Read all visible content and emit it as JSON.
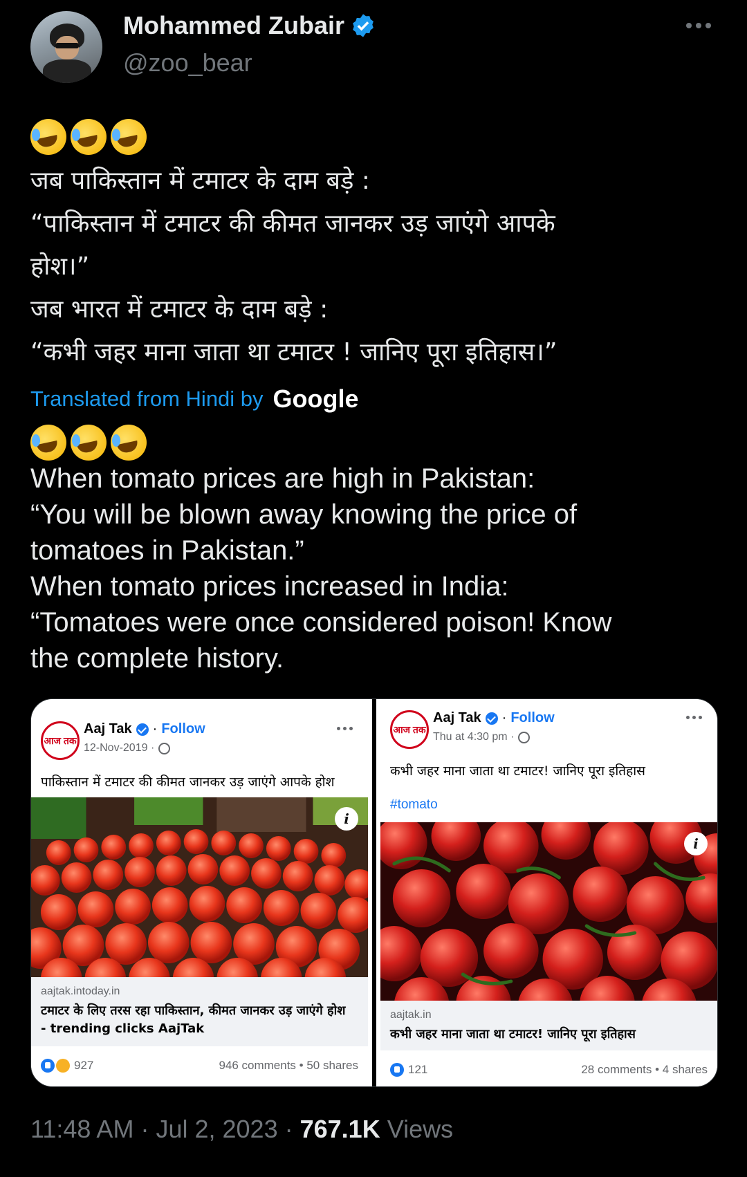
{
  "author": {
    "name": "Mohammed Zubair",
    "handle": "@zoo_bear"
  },
  "tweet": {
    "hindi_lines": [
      "जब पाकिस्तान में टमाटर के दाम बड़े :",
      "“पाकिस्तान में टमाटर की कीमत जानकर उड़ जाएंगे आपके",
      "होश।”",
      "जब भारत में टमाटर के दाम बड़े :",
      "“कभी जहर माना जाता था टमाटर ! जानिए पूरा इतिहास।”"
    ],
    "translated_label": "Translated from Hindi by",
    "translated_brand": "Google",
    "english_lines": [
      "When tomato prices are high in Pakistan:",
      "“You will be blown away knowing the price of",
      "tomatoes in Pakistan.”",
      "When tomato prices increased in India:",
      "“Tomatoes were once considered poison! Know",
      "the complete history."
    ]
  },
  "media": {
    "left": {
      "logo_text": "आज तक",
      "page": "Aaj Tak",
      "follow": "Follow",
      "date": "12-Nov-2019 ·",
      "text": "पाकिस्तान में टमाटर की कीमत जानकर उड़ जाएंगे आपके होश",
      "domain": "aajtak.intoday.in",
      "link_title_1": "टमाटर के लिए तरस रहा पाकिस्तान, कीमत जानकर उड़ जाएंगे होश",
      "link_title_2": "- trending clicks AajTak",
      "reactions": "927",
      "comments_shares": "946 comments • 50 shares"
    },
    "right": {
      "logo_text": "आज तक",
      "page": "Aaj Tak",
      "follow": "Follow",
      "date": "Thu at 4:30 pm ·",
      "text": "कभी जहर माना जाता था टमाटर! जानिए पूरा इतिहास",
      "hashtag": "#tomato",
      "domain": "aajtak.in",
      "link_title": "कभी जहर माना जाता था टमाटर! जानिए पूरा इतिहास",
      "reactions": "121",
      "comments_shares": "28 comments • 4 shares"
    }
  },
  "footer": {
    "time": "11:48 AM",
    "date": "Jul 2, 2023",
    "views_count": "767.1K",
    "views_label": "Views"
  },
  "colors": {
    "background": "#000000",
    "text": "#e7e9ea",
    "muted": "#71767b",
    "accent": "#1d9bf0",
    "fb_blue": "#1877f2",
    "aajtak_red": "#d0021b"
  },
  "icons": [
    "verified-badge-icon",
    "more-options-icon",
    "rofl-emoji",
    "globe-icon",
    "info-icon",
    "like-reaction-icon",
    "haha-reaction-icon"
  ]
}
